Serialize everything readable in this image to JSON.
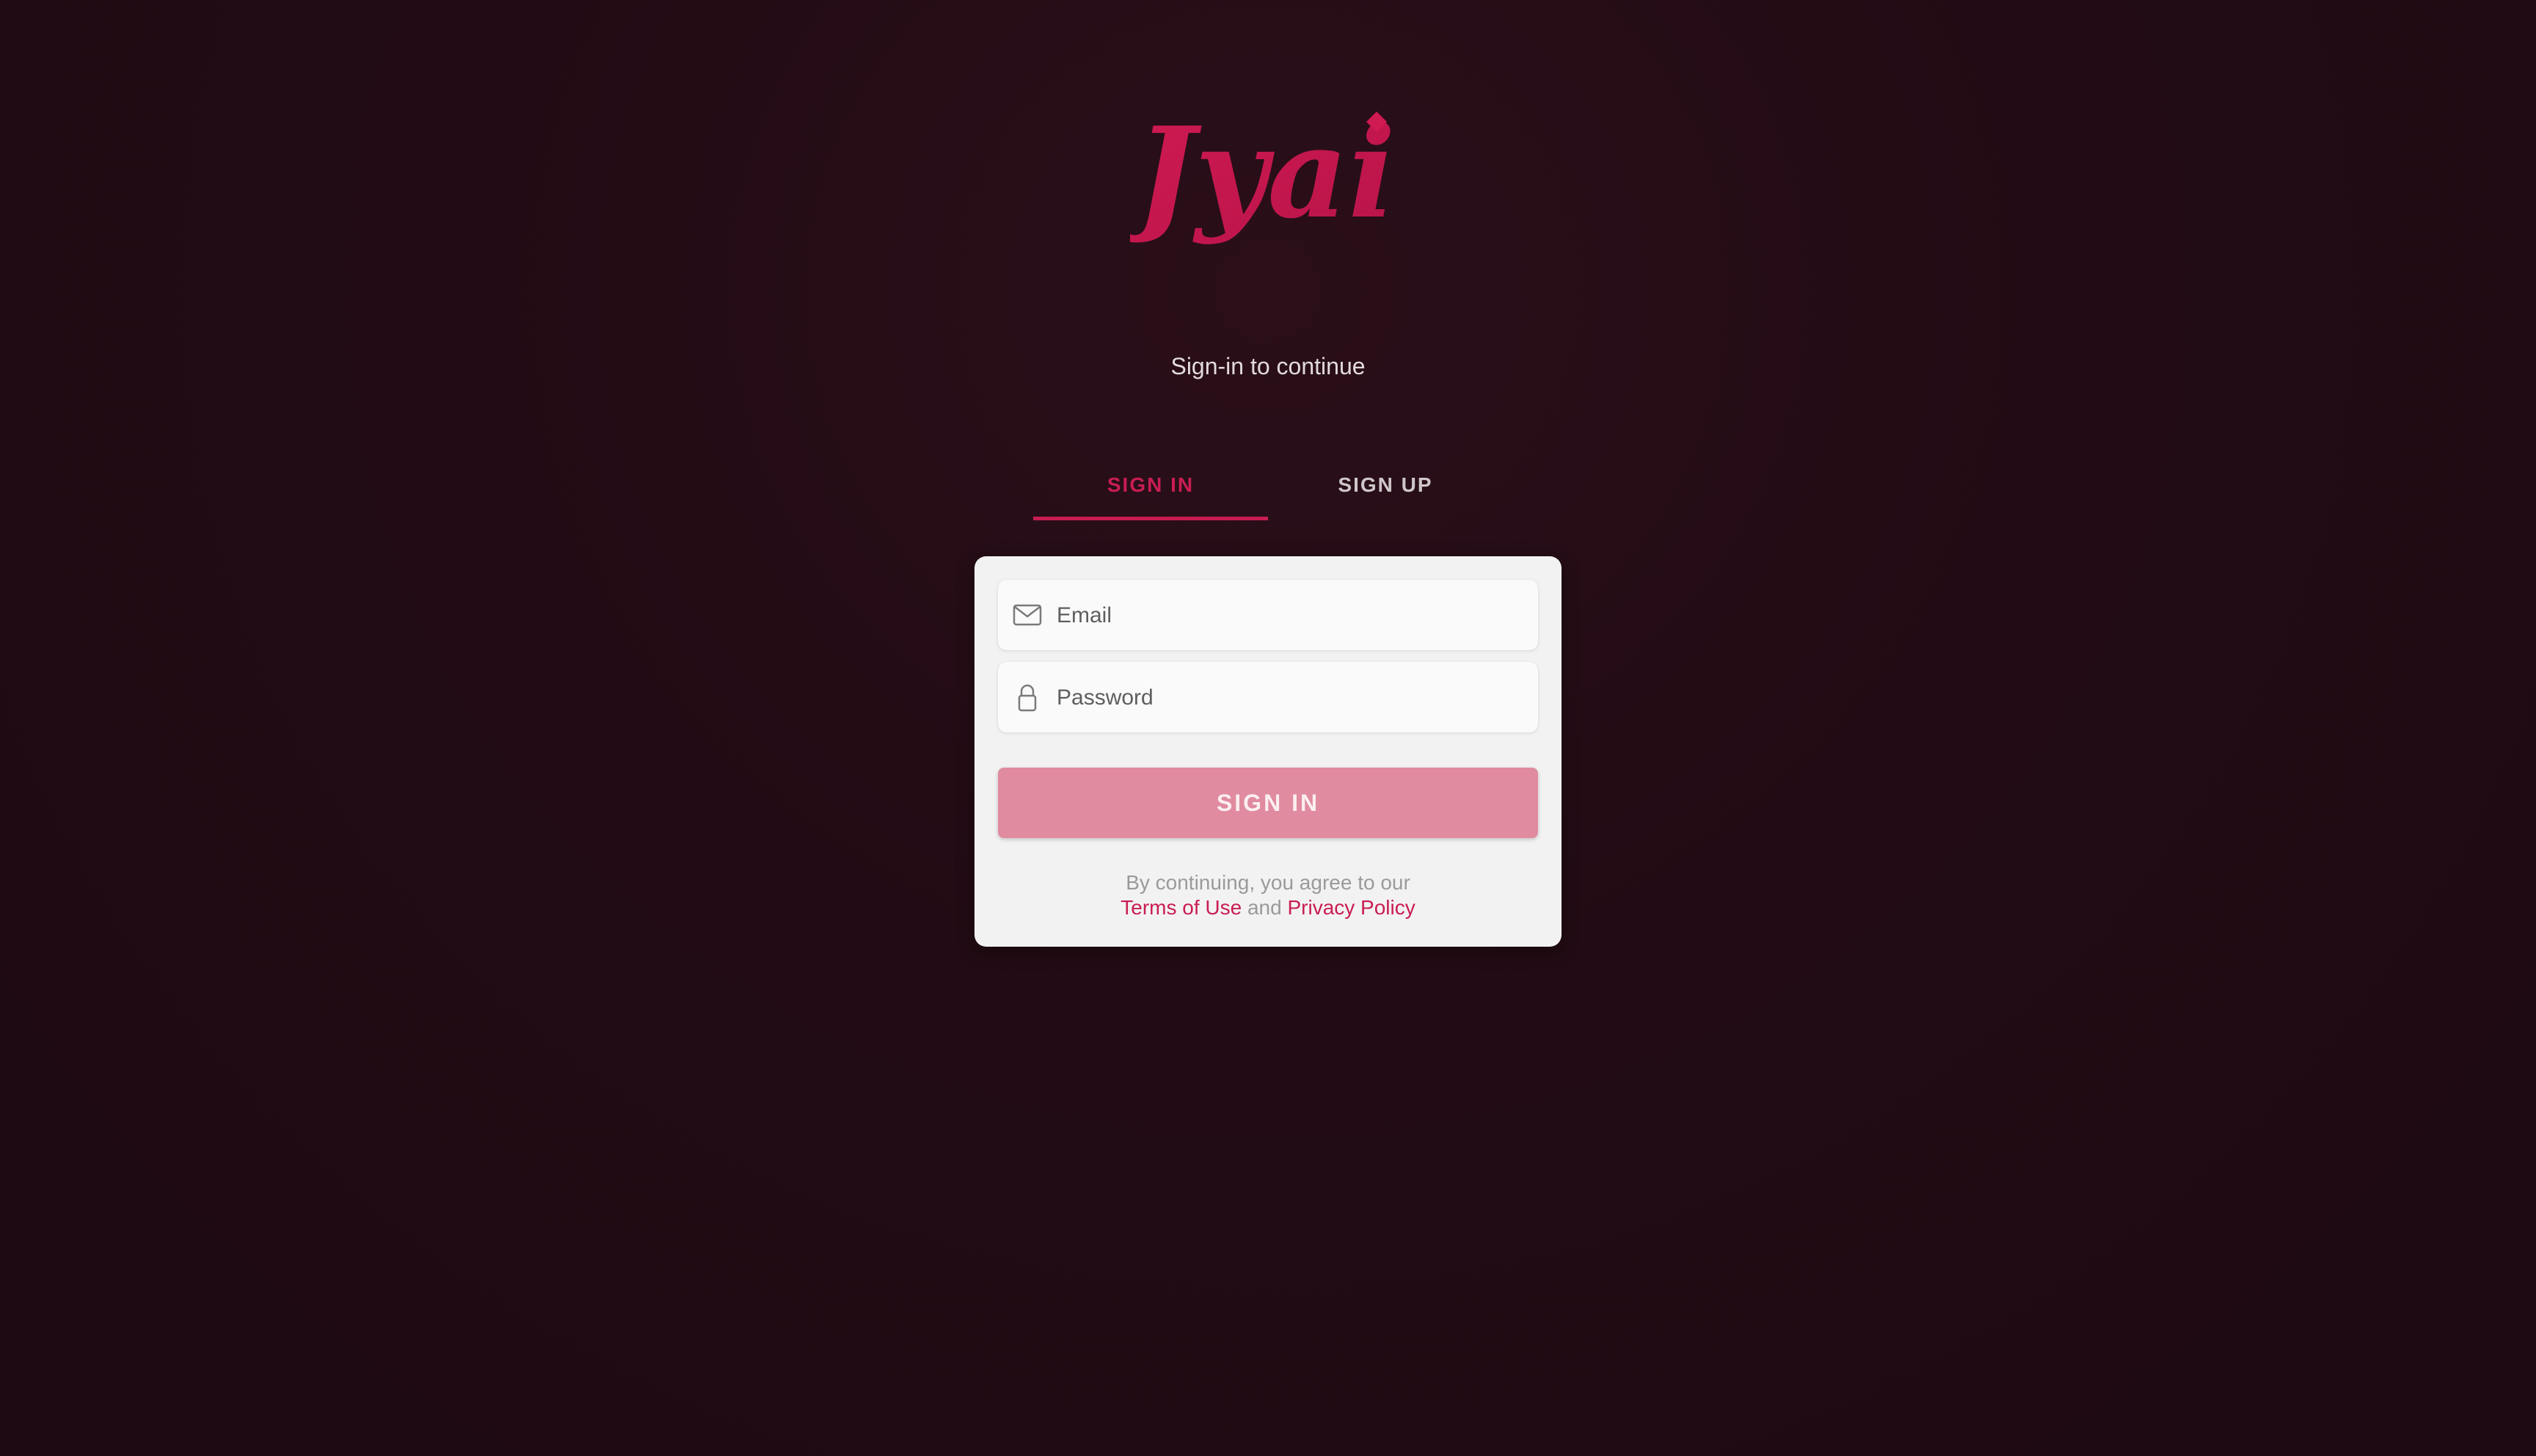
{
  "brand": {
    "logo_text": "Jyai",
    "accent_color": "#c81d52"
  },
  "header": {
    "subtitle": "Sign-in to continue"
  },
  "tabs": [
    {
      "label": "SIGN IN",
      "active": true
    },
    {
      "label": "SIGN UP",
      "active": false
    }
  ],
  "form": {
    "email": {
      "placeholder": "Email",
      "value": "",
      "icon": "envelope-icon"
    },
    "password": {
      "placeholder": "Password",
      "value": "",
      "icon": "lock-icon"
    },
    "submit_label": "SIGN IN",
    "submit_color": "#e08b9f"
  },
  "legal": {
    "prefix": "By continuing, you agree to our",
    "terms_label": "Terms of Use",
    "conjunction": "and",
    "privacy_label": "Privacy Policy"
  }
}
